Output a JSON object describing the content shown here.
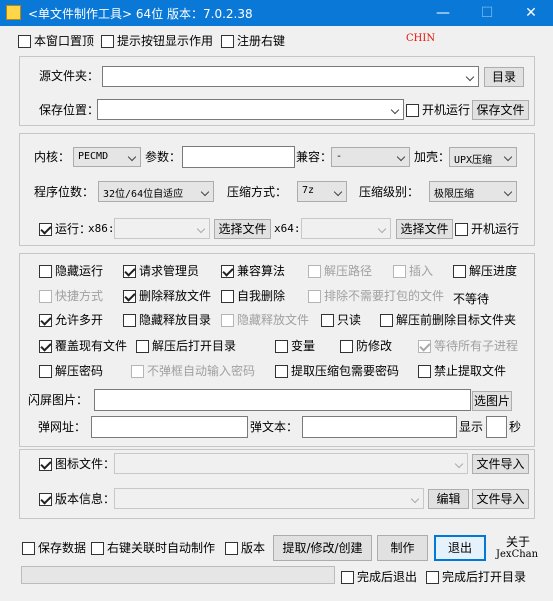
{
  "window": {
    "title": "<单文件制作工具> 64位 版本：7.0.2.38",
    "minimize": "—",
    "maximize": "☐",
    "close": "✕"
  },
  "top": {
    "stay_on_top": "本窗口置顶",
    "tooltips": "提示按钮显示作用",
    "register_context": "注册右键",
    "brand": "CHIN"
  },
  "source": {
    "label": "源文件夹：",
    "button": "目录"
  },
  "save": {
    "label": "保存位置：",
    "startup": "开机运行",
    "button": "保存文件"
  },
  "core": {
    "kernel_label": "内核：",
    "kernel_value": "PECMD",
    "params_label": "参数：",
    "compat_label": "兼容：",
    "compat_value": "-",
    "shell_label": "加壳：",
    "shell_value": "UPX压缩"
  },
  "bits": {
    "label": "程序位数：",
    "value": "32位/64位自适应",
    "method_label": "压缩方式：",
    "method_value": "7z",
    "level_label": "压缩级别：",
    "level_value": "极限压缩"
  },
  "run": {
    "label": "运行：",
    "x86": "x86:",
    "x64": "x64:",
    "select1": "选择文件",
    "select2": "选择文件",
    "startup": "开机运行"
  },
  "options": {
    "hide_run": "隐藏运行",
    "request_admin": "请求管理员",
    "compat_algo": "兼容算法",
    "extract_path": "解压路径",
    "insert": "插入",
    "extract_progress": "解压进度",
    "shortcut": "快捷方式",
    "delete_released": "删除释放文件",
    "self_delete": "自我删除",
    "exclude_files": "排除不需要打包的文件",
    "no_wait": "不等待",
    "allow_multi": "允许多开",
    "hide_release_dir": "隐藏释放目录",
    "hide_release_file": "隐藏释放文件",
    "readonly": "只读",
    "delete_target_before": "解压前删除目标文件夹",
    "overwrite": "覆盖现有文件",
    "open_dir_after": "解压后打开目录",
    "variable": "变量",
    "anti_modify": "防修改",
    "wait_children": "等待所有子进程",
    "extract_password": "解压密码",
    "no_popup_password": "不弹框自动输入密码",
    "need_password": "提取压缩包需要密码",
    "forbid_extract": "禁止提取文件"
  },
  "splash": {
    "label": "闪屏图片：",
    "button": "选图片"
  },
  "popup": {
    "url_label": "弹网址：",
    "text_label": "弹文本：",
    "show_label": "显示",
    "seconds_label": "秒"
  },
  "icon_file": {
    "label": "图标文件：",
    "button": "文件导入"
  },
  "version_info": {
    "label": "版本信息：",
    "edit": "编辑",
    "button": "文件导入"
  },
  "bottom": {
    "save_data": "保存数据",
    "auto_make": "右键关联时自动制作",
    "version": "版本",
    "extract_button": "提取/修改/创建",
    "make_button": "制作",
    "exit_button": "退出",
    "about": "关于",
    "author": "JexChan",
    "exit_after": "完成后退出",
    "open_after": "完成后打开目录"
  }
}
